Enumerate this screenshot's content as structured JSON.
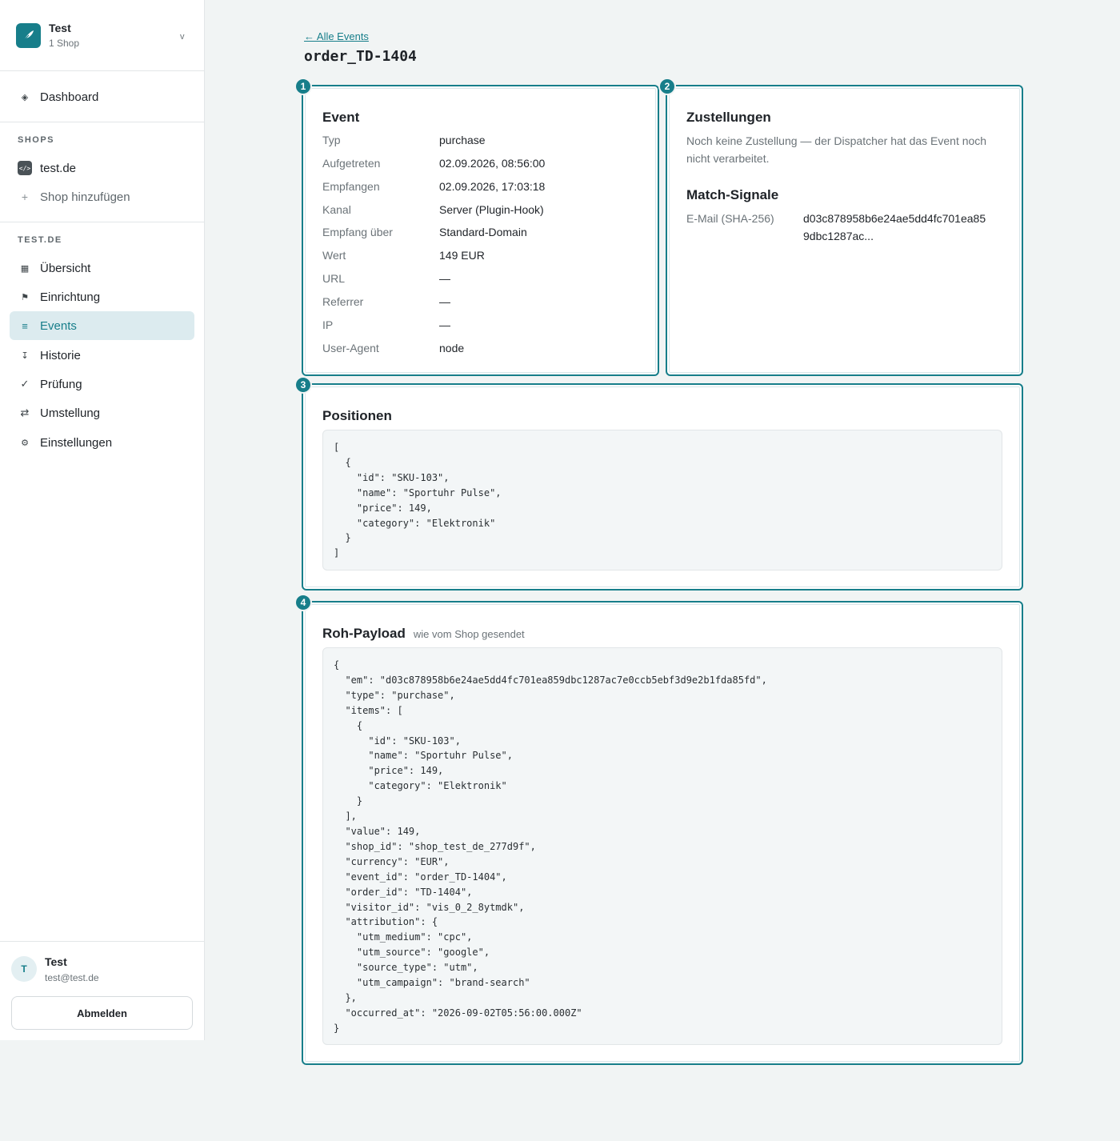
{
  "workspace": {
    "name": "Test",
    "sub": "1 Shop"
  },
  "nav_top": {
    "dashboard": "Dashboard"
  },
  "shops": {
    "label": "SHOPS",
    "shop": "test.de",
    "add": "Shop hinzufügen"
  },
  "shop_nav": {
    "label": "TEST.DE",
    "items": [
      "Übersicht",
      "Einrichtung",
      "Events",
      "Historie",
      "Prüfung",
      "Umstellung",
      "Einstellungen"
    ]
  },
  "user": {
    "initial": "T",
    "name": "Test",
    "email": "test@test.de",
    "logout": "Abmelden"
  },
  "header": {
    "back": "← Alle Events",
    "title": "order_TD-1404"
  },
  "badges": [
    "1",
    "2",
    "3",
    "4"
  ],
  "event": {
    "title": "Event",
    "rows": [
      {
        "k": "Typ",
        "v": "purchase"
      },
      {
        "k": "Aufgetreten",
        "v": "02.09.2026, 08:56:00"
      },
      {
        "k": "Empfangen",
        "v": "02.09.2026, 17:03:18"
      },
      {
        "k": "Kanal",
        "v": "Server (Plugin-Hook)"
      },
      {
        "k": "Empfang über",
        "v": "Standard-Domain"
      },
      {
        "k": "Wert",
        "v": "149 EUR"
      },
      {
        "k": "URL",
        "v": "—"
      },
      {
        "k": "Referrer",
        "v": "—"
      },
      {
        "k": "IP",
        "v": "—"
      },
      {
        "k": "User-Agent",
        "v": "node"
      }
    ]
  },
  "deliveries": {
    "title": "Zustellungen",
    "note_1": "Noch keine Zustellung — der Dispatcher hat das Event noch",
    "note_2": "nicht verarbeitet.",
    "match_title": "Match-Signale",
    "match_key": "E-Mail (SHA-256)",
    "match_val_1": "d03c878958b6e24ae5dd4fc701ea85",
    "match_val_2": "9dbc1287ac..."
  },
  "positions": {
    "title": "Positionen",
    "code": "[\n  {\n    \"id\": \"SKU-103\",\n    \"name\": \"Sportuhr Pulse\",\n    \"price\": 149,\n    \"category\": \"Elektronik\"\n  }\n]"
  },
  "payload": {
    "title": "Roh-Payload",
    "subtitle": "wie vom Shop gesendet",
    "code": "{\n  \"em\": \"d03c878958b6e24ae5dd4fc701ea859dbc1287ac7e0ccb5ebf3d9e2b1fda85fd\",\n  \"type\": \"purchase\",\n  \"items\": [\n    {\n      \"id\": \"SKU-103\",\n      \"name\": \"Sportuhr Pulse\",\n      \"price\": 149,\n      \"category\": \"Elektronik\"\n    }\n  ],\n  \"value\": 149,\n  \"shop_id\": \"shop_test_de_277d9f\",\n  \"currency\": \"EUR\",\n  \"event_id\": \"order_TD-1404\",\n  \"order_id\": \"TD-1404\",\n  \"visitor_id\": \"vis_0_2_8ytmdk\",\n  \"attribution\": {\n    \"utm_medium\": \"cpc\",\n    \"utm_source\": \"google\",\n    \"source_type\": \"utm\",\n    \"utm_campaign\": \"brand-search\"\n  },\n  \"occurred_at\": \"2026-09-02T05:56:00.000Z\"\n}"
  },
  "colors": {
    "accent": "#177e8a",
    "background": "#f1f4f4",
    "active_bg": "#dcebef"
  },
  "icons": {
    "workspace": "feather-logo-icon",
    "chevron": "chevron-down-icon",
    "dashboard": "diamond-icon",
    "shop": "code-icon",
    "add": "plus-icon",
    "uebersicht": "grid-icon",
    "einrichtung": "flag-icon",
    "events": "list-icon",
    "historie": "history-icon",
    "pruefung": "check-icon",
    "umstellung": "swap-icon",
    "einstellungen": "gear-icon"
  }
}
